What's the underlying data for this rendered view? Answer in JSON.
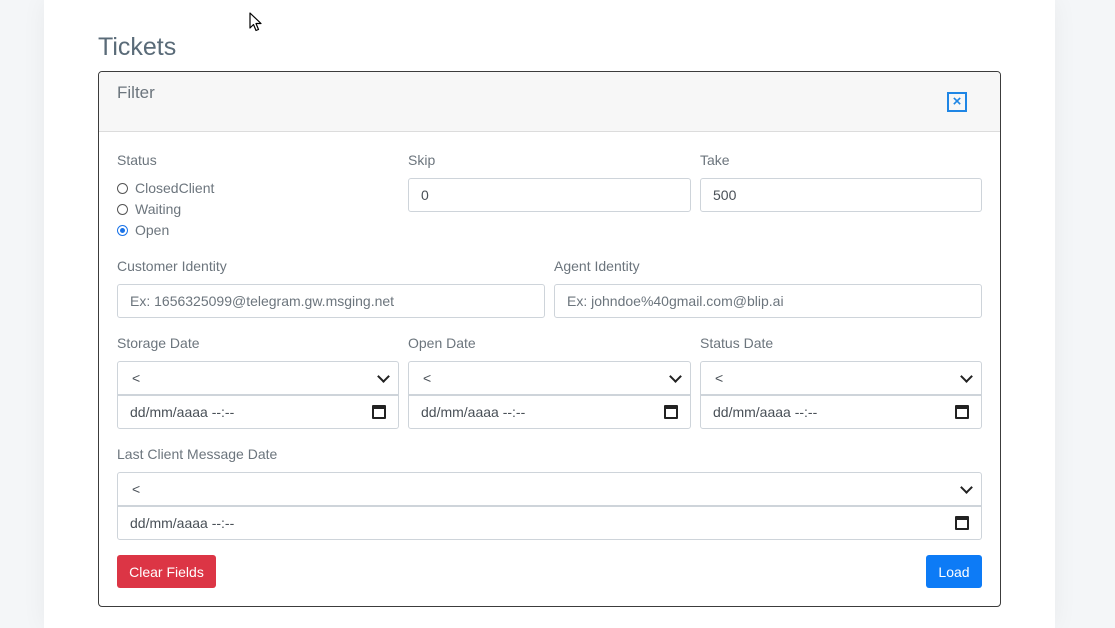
{
  "page": {
    "title": "Tickets"
  },
  "filter": {
    "title": "Filter",
    "close_icon": "close-icon",
    "status": {
      "label": "Status",
      "options": [
        {
          "label": "ClosedClient",
          "checked": false
        },
        {
          "label": "Waiting",
          "checked": false
        },
        {
          "label": "Open",
          "checked": true
        }
      ]
    },
    "skip": {
      "label": "Skip",
      "value": "0"
    },
    "take": {
      "label": "Take",
      "value": "500"
    },
    "customer_identity": {
      "label": "Customer Identity",
      "placeholder": "Ex: 1656325099@telegram.gw.msging.net"
    },
    "agent_identity": {
      "label": "Agent Identity",
      "placeholder": "Ex: johndoe%40gmail.com@blip.ai"
    },
    "storage_date": {
      "label": "Storage Date",
      "operator": "<",
      "date_placeholder": "dd/mm/aaaa --:--"
    },
    "open_date": {
      "label": "Open Date",
      "operator": "<",
      "date_placeholder": "dd/mm/aaaa --:--"
    },
    "status_date": {
      "label": "Status Date",
      "operator": "<",
      "date_placeholder": "dd/mm/aaaa --:--"
    },
    "last_client_message_date": {
      "label": "Last Client Message Date",
      "operator": "<",
      "date_placeholder": "dd/mm/aaaa --:--"
    },
    "clear_button": "Clear Fields",
    "load_button": "Load"
  },
  "colors": {
    "danger": "#dc3545",
    "primary": "#0d7bf6",
    "accent": "#1f86e5"
  }
}
